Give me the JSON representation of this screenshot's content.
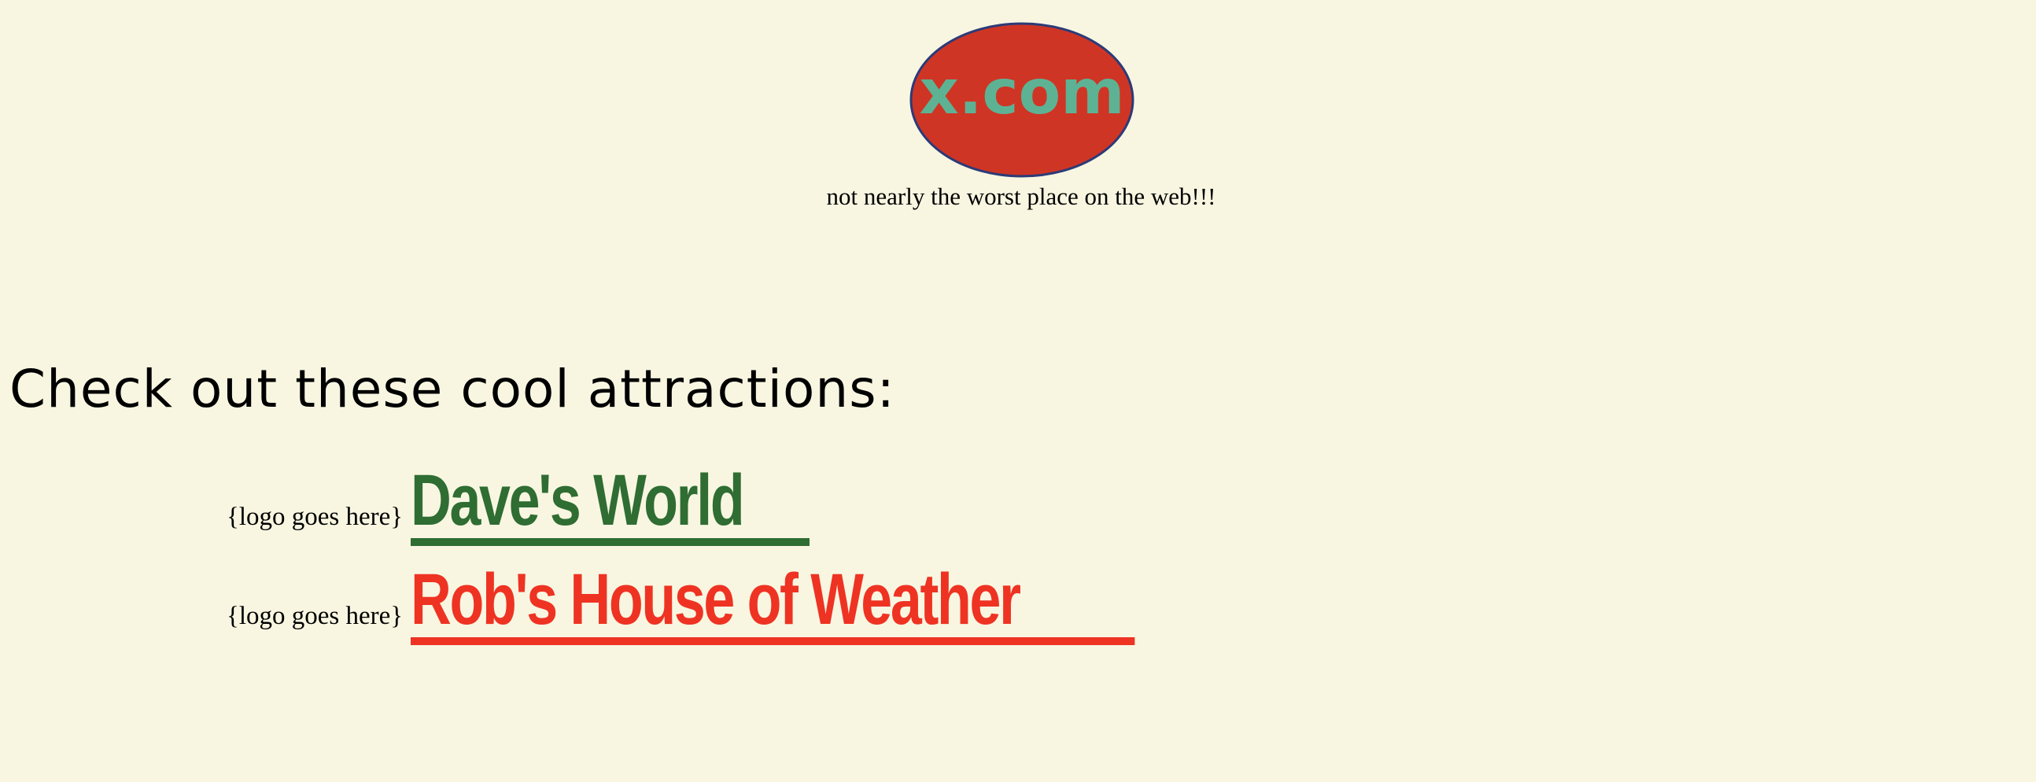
{
  "header": {
    "logo_text": "x.com",
    "logo_colors": {
      "oval": "#cf3525",
      "oval_border": "#2b3b78",
      "text": "#5eb294"
    },
    "tagline": "not nearly the worst place on the web!!!"
  },
  "main": {
    "heading": "Check out these cool attractions:",
    "attractions": [
      {
        "logo_placeholder": "{logo goes here}",
        "link_text": "Dave's World",
        "color": "#2f6d33"
      },
      {
        "logo_placeholder": "{logo goes here}",
        "link_text": "Rob's House of Weather",
        "color": "#ee3323"
      }
    ]
  }
}
